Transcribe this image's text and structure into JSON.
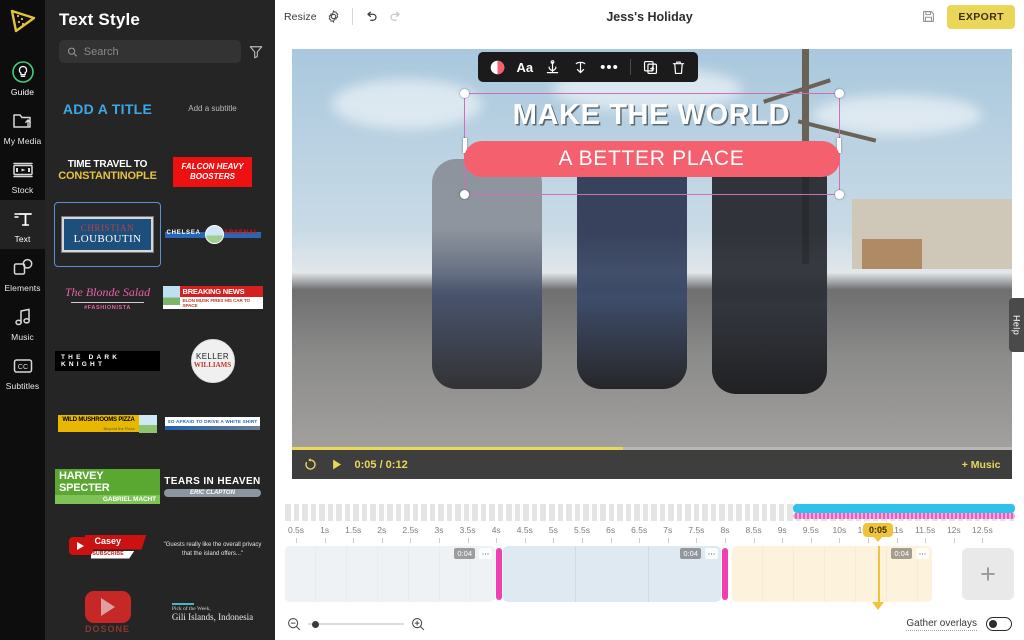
{
  "rail": {
    "logo_icon": "play-triangle-logo",
    "items": [
      {
        "label": "Guide",
        "icon": "lightbulb-icon",
        "active": false
      },
      {
        "label": "My Media",
        "icon": "folder-upload-icon",
        "active": false
      },
      {
        "label": "Stock",
        "icon": "film-strip-icon",
        "active": false
      },
      {
        "label": "Text",
        "icon": "text-tool-icon",
        "active": true
      },
      {
        "label": "Elements",
        "icon": "shapes-icon",
        "active": false
      },
      {
        "label": "Music",
        "icon": "music-note-icon",
        "active": false
      },
      {
        "label": "Subtitles",
        "icon": "closed-caption-icon",
        "active": false
      }
    ]
  },
  "panel": {
    "title": "Text Style",
    "search": {
      "value": "",
      "placeholder": "Search",
      "icon": "search-icon"
    },
    "filter_icon": "filter-funnel-icon",
    "templates": [
      {
        "name": "add-a-title",
        "text": "ADD A TITLE"
      },
      {
        "name": "add-a-subtitle",
        "text": "Add a subtitle"
      },
      {
        "name": "time-travel-constantinople",
        "line1": "TIME TRAVEL TO",
        "line2": "CONSTANTINOPLE"
      },
      {
        "name": "falcon-heavy-boosters",
        "line1": "FALCON HEAVY",
        "line2": "BOOSTERS"
      },
      {
        "name": "christian-louboutin",
        "line1": "CHRISTIAN",
        "line2": "LOUBOUTIN",
        "selected": true
      },
      {
        "name": "chelsea-arsenal",
        "left": "CHELSEA",
        "right": "ARSENAL"
      },
      {
        "name": "the-blonde-salad",
        "line1": "The Blonde Salad",
        "line2": "#FASHIONISTA"
      },
      {
        "name": "breaking-news",
        "line1": "BREAKING NEWS",
        "line2": "ELON MUSK FIRES HIS CAR TO SPACE"
      },
      {
        "name": "the-dark-knight",
        "text": "THE DARK KNIGHT"
      },
      {
        "name": "keller-williams",
        "line1": "KELLER",
        "line2": "WILLIAMS"
      },
      {
        "name": "wild-mushrooms-pizza",
        "line1": "WILD MUSHROOMS PIZZA",
        "line2": "Beyond the Pizza"
      },
      {
        "name": "so-afraid-to-drive",
        "text": "SO AFRAID TO DRIVE A WHITE SHIRT"
      },
      {
        "name": "harvey-specter",
        "line1": "HARVEY SPECTER",
        "line2": "GABRIEL MACHT"
      },
      {
        "name": "tears-in-heaven",
        "line1": "TEARS IN HEAVEN",
        "line2": "ERIC CLAPTON"
      },
      {
        "name": "casey-subscribe",
        "line1": "Casey",
        "line2": "SUBSCRIBE"
      },
      {
        "name": "guest-quote",
        "text": "\"Guests really like the overall privacy that the island offers...\""
      },
      {
        "name": "dosone-youtube",
        "text": "DOSONE"
      },
      {
        "name": "gili-islands",
        "line1": "Pick of the Week,",
        "line2": "Gili Islands, Indonesia"
      }
    ]
  },
  "topbar": {
    "resize_label": "Resize",
    "settings_icon": "gear-icon",
    "undo_icon": "undo-arrow-icon",
    "redo_icon": "redo-arrow-icon",
    "project_title": "Jess's Holiday",
    "save_icon": "floppy-save-icon",
    "export_label": "EXPORT",
    "export_color": "#ead75a"
  },
  "preview": {
    "selection_toolbar": {
      "color_icon": "half-circle-color-icon",
      "font_label": "Aa",
      "anchor_icon": "anchor-align-icon",
      "animate_icon": "animation-arrow-icon",
      "more_icon": "ellipsis-icon",
      "duplicate_icon": "duplicate-icon",
      "delete_icon": "trash-icon"
    },
    "overlay_text": {
      "line1": "MAKE THE WORLD",
      "line2": "A BETTER PLACE",
      "line2_bg": "#f5606f",
      "selection_border": "#d06fb8"
    },
    "rotate_icon": "rotate-handle-icon"
  },
  "playback": {
    "loop_icon": "loop-icon",
    "play_icon": "play-icon",
    "current_time": "0:05",
    "separator": "/",
    "total_time": "0:12",
    "time_display": "0:05 / 0:12",
    "music_label": "+ Music",
    "progress_percent": 46,
    "accent_color": "#ead75a"
  },
  "help_tab": {
    "label": "Help"
  },
  "timeline": {
    "ruler_labels": [
      "0.5s",
      "1s",
      "1.5s",
      "2s",
      "2.5s",
      "3s",
      "3.5s",
      "4s",
      "4.5s",
      "5s",
      "5.5s",
      "6s",
      "6.5s",
      "7s",
      "7.5s",
      "8s",
      "8.5s",
      "9s",
      "9.5s",
      "10s",
      "10.5s",
      "11s",
      "11.5s",
      "12s",
      "12.5s"
    ],
    "playhead_label": "0:05",
    "playhead_color": "#f0c33c",
    "overlay_track": {
      "top_color": "#2fc2e8",
      "bottom_color": "#e45fc0"
    },
    "clips": [
      {
        "name": "clip-1",
        "duration": "0:04",
        "more": "⋯",
        "selected": false
      },
      {
        "name": "clip-2",
        "duration": "0:04",
        "more": "⋯",
        "selected": true
      },
      {
        "name": "clip-3",
        "duration": "0:04",
        "more": "⋯",
        "selected": false
      }
    ],
    "add_clip_label": "+",
    "trim_handle_color": "#f03fb0"
  },
  "bottombar": {
    "zoom_out_icon": "zoom-out-icon",
    "zoom_in_icon": "zoom-in-icon",
    "zoom_value": 5,
    "gather_overlays_label": "Gather overlays",
    "gather_overlays_on": false
  }
}
